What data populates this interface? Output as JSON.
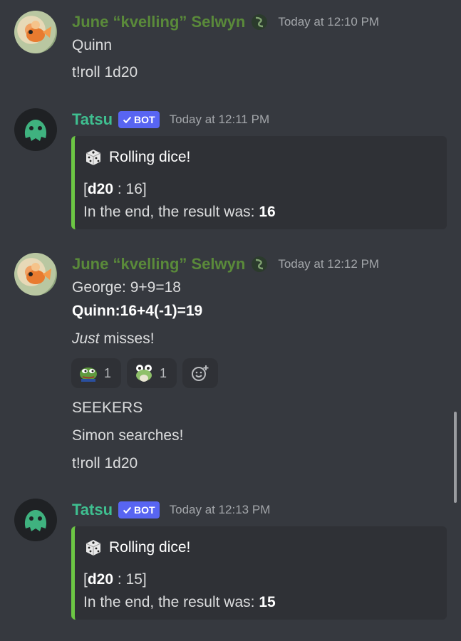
{
  "messages": [
    {
      "author": "June “kvelling” Selwyn",
      "timestamp": "Today at 12:10 PM",
      "lines": [
        "Quinn",
        "t!roll 1d20"
      ]
    },
    {
      "author": "Tatsu",
      "bot_tag": "BOT",
      "timestamp": "Today at 12:11 PM",
      "embed": {
        "title": "Rolling dice!",
        "roll_open": "[",
        "roll_die": "d20",
        "roll_value": " : 16]",
        "result_prefix": "In the end, the result was: ",
        "result_value": "16"
      }
    },
    {
      "author": "June “kvelling” Selwyn",
      "timestamp": "Today at 12:12 PM",
      "line1": "George: 9+9=18",
      "line2": "Quinn:16+4(-1)=19",
      "line3_em": "Just",
      "line3_rest": " misses!",
      "reactions": [
        {
          "emoji": "pepe-emoji",
          "count": "1"
        },
        {
          "emoji": "frog-emoji",
          "count": "1"
        }
      ],
      "after_lines": [
        "SEEKERS",
        "Simon searches!",
        "t!roll 1d20"
      ]
    },
    {
      "author": "Tatsu",
      "bot_tag": "BOT",
      "timestamp": "Today at 12:13 PM",
      "embed": {
        "title": "Rolling dice!",
        "roll_open": "[",
        "roll_die": "d20",
        "roll_value": " : 15]",
        "result_prefix": "In the end, the result was: ",
        "result_value": "15"
      }
    }
  ],
  "colors": {
    "background": "#36393f",
    "embed_background": "#2f3136",
    "embed_accent": "#6cc644",
    "june_name": "#5a8a3a",
    "tatsu_name": "#3fbf90",
    "bot_tag": "#5865f2"
  }
}
